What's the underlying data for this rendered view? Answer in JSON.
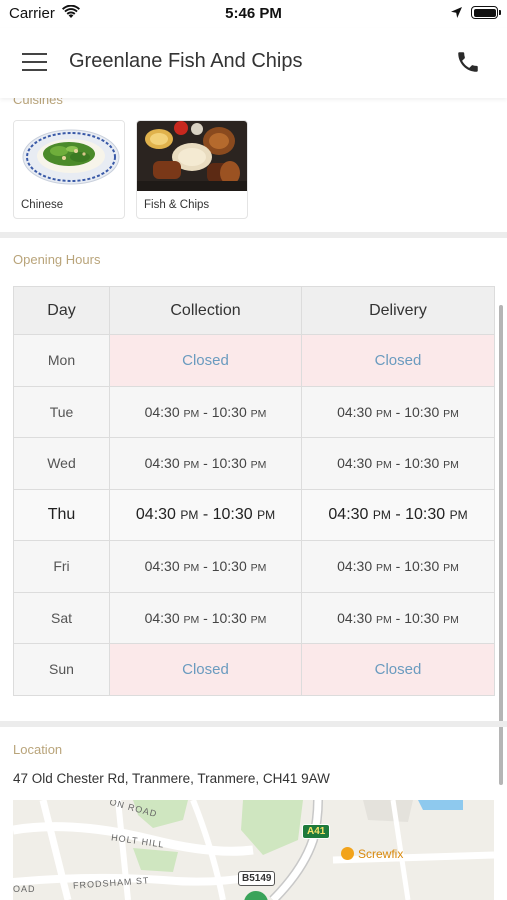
{
  "status_bar": {
    "carrier": "Carrier",
    "time": "5:46 PM"
  },
  "nav": {
    "title": "Greenlane Fish And Chips",
    "menu_icon": "hamburger-menu-icon",
    "phone_icon": "phone-icon"
  },
  "cuisines": {
    "label": "Cuisines",
    "items": [
      {
        "name": "Chinese"
      },
      {
        "name": "Fish & Chips"
      }
    ]
  },
  "opening_hours": {
    "label": "Opening Hours",
    "headers": {
      "day": "Day",
      "collection": "Collection",
      "delivery": "Delivery"
    },
    "rows": [
      {
        "day": "Mon",
        "collection": {
          "closed": "Closed"
        },
        "delivery": {
          "closed": "Closed"
        }
      },
      {
        "day": "Tue",
        "collection": {
          "start": "04:30",
          "start_suffix": "PM",
          "end": "10:30",
          "end_suffix": "PM"
        },
        "delivery": {
          "start": "04:30",
          "start_suffix": "PM",
          "end": "10:30",
          "end_suffix": "PM"
        }
      },
      {
        "day": "Wed",
        "collection": {
          "start": "04:30",
          "start_suffix": "PM",
          "end": "10:30",
          "end_suffix": "PM"
        },
        "delivery": {
          "start": "04:30",
          "start_suffix": "PM",
          "end": "10:30",
          "end_suffix": "PM"
        }
      },
      {
        "day": "Thu",
        "collection": {
          "start": "04:30",
          "start_suffix": "PM",
          "end": "10:30",
          "end_suffix": "PM"
        },
        "delivery": {
          "start": "04:30",
          "start_suffix": "PM",
          "end": "10:30",
          "end_suffix": "PM"
        }
      },
      {
        "day": "Fri",
        "collection": {
          "start": "04:30",
          "start_suffix": "PM",
          "end": "10:30",
          "end_suffix": "PM"
        },
        "delivery": {
          "start": "04:30",
          "start_suffix": "PM",
          "end": "10:30",
          "end_suffix": "PM"
        }
      },
      {
        "day": "Sat",
        "collection": {
          "start": "04:30",
          "start_suffix": "PM",
          "end": "10:30",
          "end_suffix": "PM"
        },
        "delivery": {
          "start": "04:30",
          "start_suffix": "PM",
          "end": "10:30",
          "end_suffix": "PM"
        }
      },
      {
        "day": "Sun",
        "collection": {
          "closed": "Closed"
        },
        "delivery": {
          "closed": "Closed"
        }
      }
    ]
  },
  "location": {
    "label": "Location",
    "address": "47 Old Chester Rd, Tranmere, Tranmere, CH41 9AW",
    "map_labels": {
      "road_1": "ON ROAD",
      "road_2": "HOLT HILL",
      "road_3": "FRODSHAM ST",
      "road_4": "OAD",
      "badge_a41": "A41",
      "badge_b5149": "B5149",
      "poi": "Screwfix"
    }
  },
  "colors": {
    "section_label": "#b9a47a",
    "closed_bg": "#fbe9ea",
    "closed_text": "#6a9bbf",
    "header_bg": "#efefef"
  }
}
